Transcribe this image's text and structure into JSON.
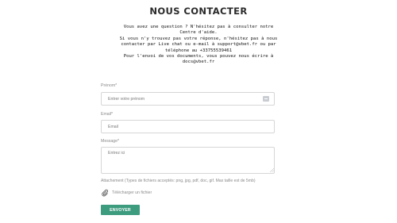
{
  "page": {
    "title": "NOUS CONTACTER",
    "intro_lines": [
      "Vous avez une question ? N'hésitez pas à consulter notre",
      "Centre d'aide.",
      "Si vous n'y trouvez pas votre réponse, n'hésitez pas à nous",
      "contacter par Live chat ou e-mail à support@vbet.fr ou par",
      "téléphone au +33755539461",
      "Pour l'envoi de vos documents, vous pouvez nous écrire à",
      "docs@vbet.fr"
    ]
  },
  "form": {
    "firstname": {
      "label": "Prénom*",
      "placeholder": "Entrer votre prénom",
      "value": ""
    },
    "email": {
      "label": "Email*",
      "placeholder": "Email",
      "value": ""
    },
    "message": {
      "label": "Message*",
      "placeholder": "Entrez ici",
      "value": ""
    },
    "attachment_note": "Attachement (Types de fichiers acceptés: png, jpg, pdf, doc, gif. Max taille est de 5mb)",
    "upload_label": "Télécharger un fichier",
    "submit_label": "ENVOYER"
  },
  "icons": {
    "autofill": "contact-card-icon",
    "upload": "paperclip-icon"
  },
  "colors": {
    "accent": "#3d9b7e",
    "label": "#8a8a8a",
    "border": "#d6d6d6"
  }
}
